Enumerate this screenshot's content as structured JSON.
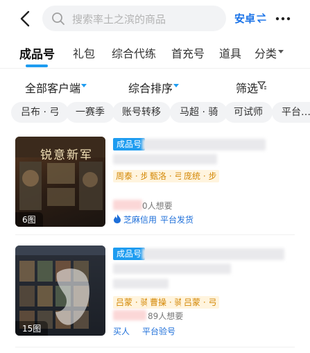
{
  "header": {
    "search_placeholder": "搜索率土之滨的商品",
    "platform_label": "安卓"
  },
  "tabs": [
    {
      "label": "成品号"
    },
    {
      "label": "礼包"
    },
    {
      "label": "综合代练"
    },
    {
      "label": "首充号"
    },
    {
      "label": "道具"
    },
    {
      "label": "分类"
    }
  ],
  "sort_bar": {
    "client_filter": "全部客户端",
    "sort_order": "综合排序",
    "filter": "筛选"
  },
  "chips": [
    "吕布 · 弓",
    "一赛季",
    "账号转移",
    "马超 · 骑",
    "可试师",
    "平台…"
  ],
  "listings": [
    {
      "badge": "成品号",
      "image_count": "6图",
      "thumb_title": "锐意新军",
      "tags": [
        "周泰 · 步",
        "甄洛 · 弓",
        "庞统 · 步"
      ],
      "want_text": "0人想要",
      "meta": [
        "芝麻信用",
        "平台发货"
      ]
    },
    {
      "badge": "成品号",
      "image_count": "15图",
      "tags": [
        "吕蒙 · 骑",
        "曹操 · 骑",
        "吕蒙 · 弓"
      ],
      "want_text": "89人想要",
      "meta": [
        "买人",
        "平台验号"
      ]
    }
  ],
  "colors": {
    "accent": "#1e9cf0",
    "tag_bg": "#fff4de",
    "tag_text": "#d48806",
    "link_blue": "#1e6fd9"
  }
}
